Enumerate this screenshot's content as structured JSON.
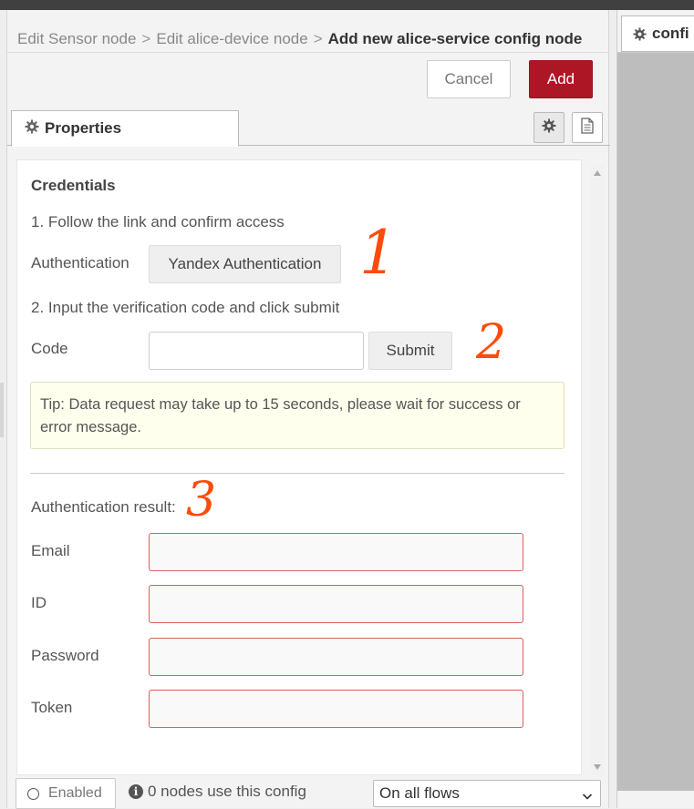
{
  "breadcrumb": {
    "items": [
      "Edit Sensor node",
      "Edit alice-device node"
    ],
    "separator": ">",
    "current": "Add new alice-service config node"
  },
  "header": {
    "cancel_label": "Cancel",
    "add_label": "Add",
    "add_color": "#ad1625"
  },
  "tabs": {
    "properties_label": "Properties",
    "icons": [
      "gear-icon",
      "description-icon"
    ]
  },
  "form": {
    "credentials_title": "Credentials",
    "step1": "1. Follow the link and confirm access",
    "auth_label": "Authentication",
    "auth_button": "Yandex Authentication",
    "step2": "2. Input the verification code and click submit",
    "code_label": "Code",
    "code_value": "",
    "submit_label": "Submit",
    "tip": "Tip: Data request may take up to 15 seconds, please wait for success or error message.",
    "result_label": "Authentication result:",
    "fields": [
      {
        "label": "Email",
        "value": ""
      },
      {
        "label": "ID",
        "value": ""
      },
      {
        "label": "Password",
        "value": ""
      },
      {
        "label": "Token",
        "value": ""
      }
    ]
  },
  "annotations": [
    "1",
    "2",
    "3"
  ],
  "annotation_color": "#ff4b0a",
  "footer": {
    "enabled_label": "Enabled",
    "usage_text": "0 nodes use this config",
    "scope_selected": "On all flows"
  },
  "right_panel": {
    "tab_label": "confi"
  }
}
